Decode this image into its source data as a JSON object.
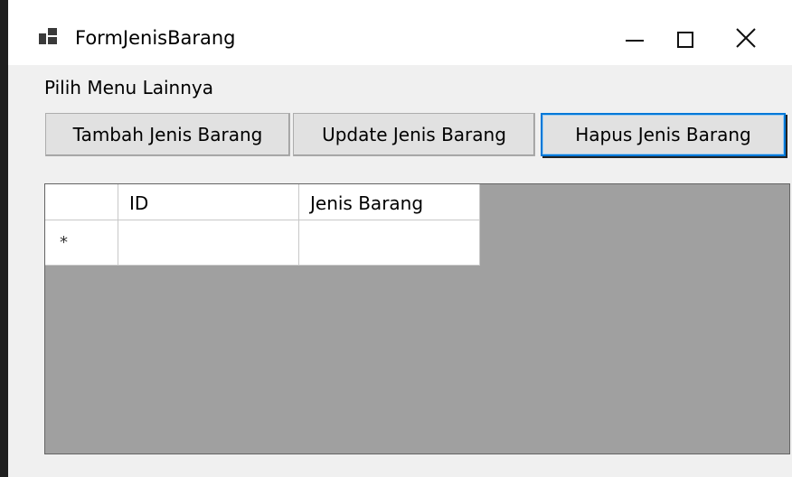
{
  "window": {
    "title": "FormJenisBarang",
    "icons": {
      "app": "form-app-icon",
      "minimize": "minimize-icon",
      "maximize": "maximize-icon",
      "close": "close-icon"
    }
  },
  "menu": {
    "items": [
      {
        "label": "Pilih Menu Lainnya"
      }
    ]
  },
  "toolbar": {
    "buttons": [
      {
        "label": "Tambah Jenis Barang"
      },
      {
        "label": "Update Jenis Barang"
      },
      {
        "label": "Hapus Jenis Barang",
        "focused": true
      }
    ]
  },
  "grid": {
    "columns": [
      {
        "header": "ID"
      },
      {
        "header": "Jenis Barang"
      }
    ],
    "rows": [
      {
        "row_header": "*",
        "cells": [
          "",
          ""
        ]
      }
    ]
  },
  "colors": {
    "grid_background": "#a0a0a0",
    "focus_border": "#0078d7"
  }
}
